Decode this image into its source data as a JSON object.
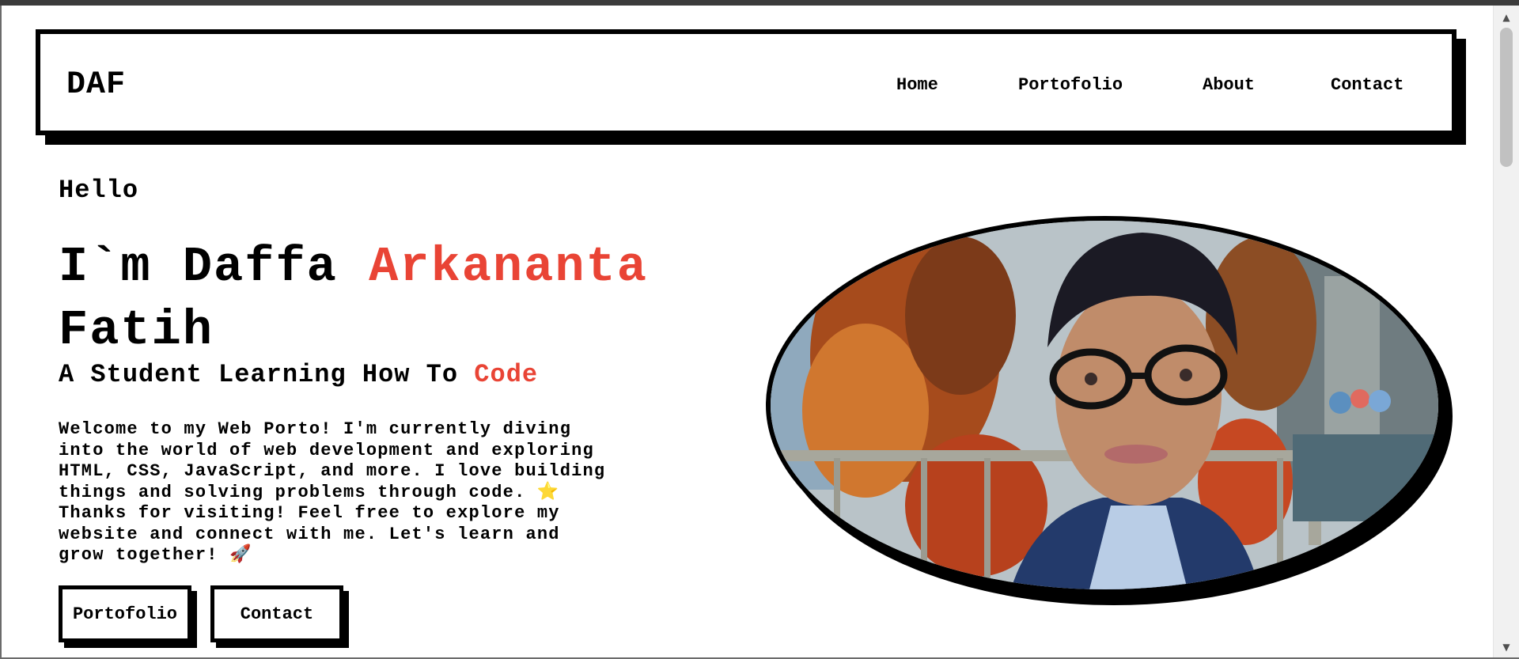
{
  "nav": {
    "logo": "DAF",
    "links": [
      {
        "label": "Home"
      },
      {
        "label": "Portofolio"
      },
      {
        "label": "About"
      },
      {
        "label": "Contact"
      }
    ]
  },
  "hero": {
    "greeting": "Hello",
    "name_prefix": "I`m Daffa",
    "name_accent": "Arkananta",
    "name_last": "Fatih",
    "tagline_prefix": "A Student Learning How To",
    "tagline_accent": "Code",
    "description": "Welcome to my Web Porto! I'm currently diving\ninto the world of web development and exploring\nHTML, CSS, JavaScript, and more. I love building\nthings and solving problems through code. ⭐\nThanks for visiting! Feel free to explore my\nwebsite and connect with me. Let's learn and\ngrow together! 🚀",
    "buttons": [
      {
        "label": "Portofolio"
      },
      {
        "label": "Contact"
      }
    ]
  },
  "colors": {
    "accent": "#e94435",
    "ink": "#000000",
    "background": "#ffffff"
  }
}
